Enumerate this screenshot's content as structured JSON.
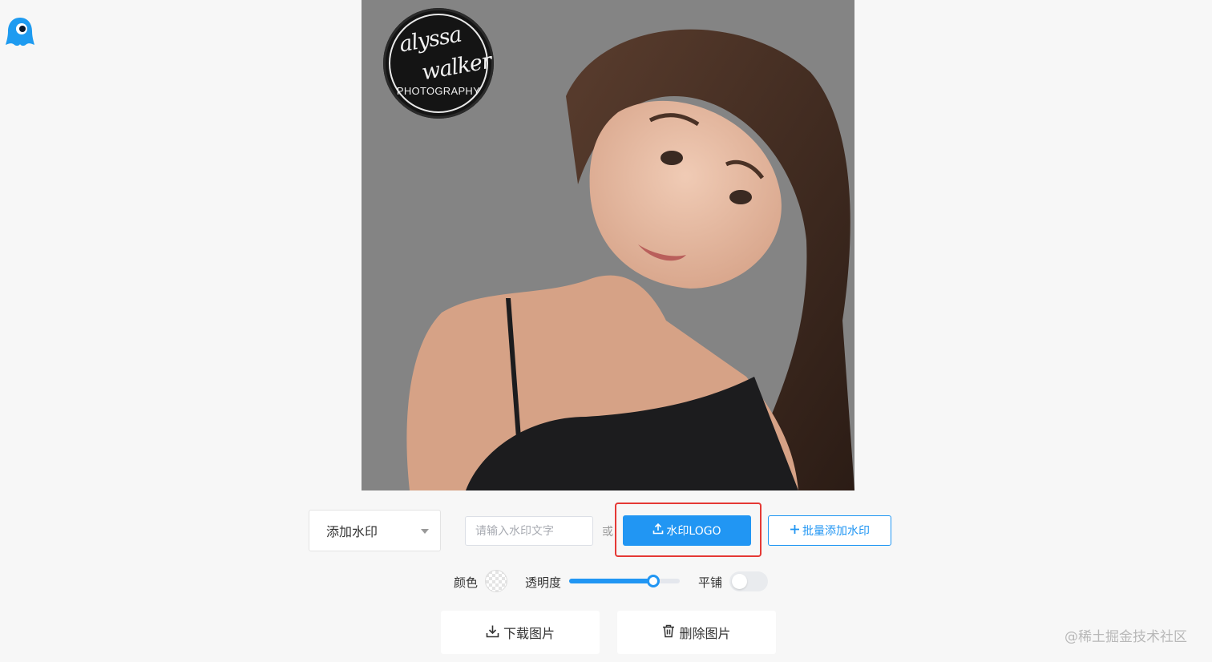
{
  "app": {
    "logo_icon": "ghost-mascot-icon",
    "accent_color": "#2196f3",
    "highlight_color": "#e53935"
  },
  "photo": {
    "watermark": {
      "script_line_1": "alyssa",
      "script_line_2": "walker",
      "subtitle": "PHOTOGRAPHY"
    }
  },
  "controls": {
    "mode_select": {
      "selected": "添加水印",
      "icon": "caret-down-icon"
    },
    "watermark_text": {
      "placeholder": "请输入水印文字",
      "value": ""
    },
    "or_label": "或",
    "upload_logo": {
      "label": "水印LOGO",
      "icon": "upload-icon"
    },
    "batch_add": {
      "label": "批量添加水印",
      "icon": "plus-icon"
    },
    "color": {
      "label": "颜色"
    },
    "opacity": {
      "label": "透明度",
      "value_percent": 76
    },
    "tile": {
      "label": "平铺",
      "enabled": false
    },
    "download": {
      "label": "下载图片",
      "icon": "download-icon"
    },
    "delete": {
      "label": "删除图片",
      "icon": "trash-icon"
    }
  },
  "footer": {
    "attribution": "@稀土掘金技术社区"
  }
}
